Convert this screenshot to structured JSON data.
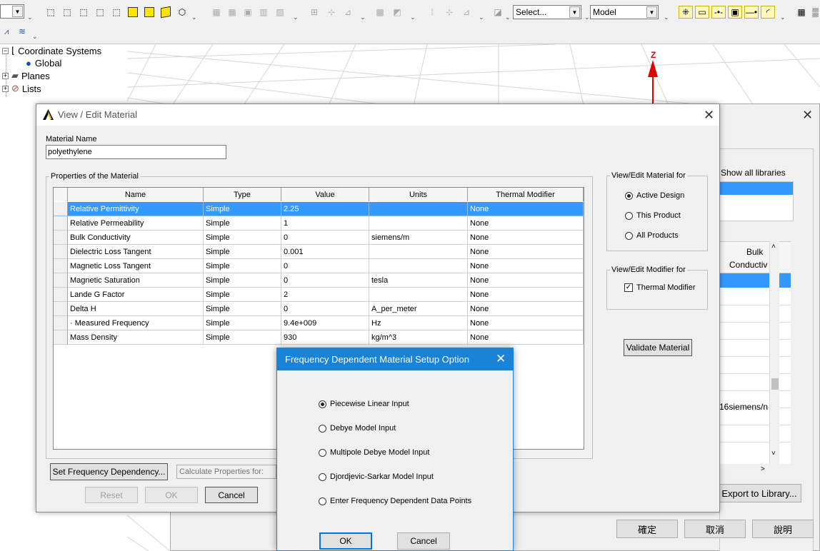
{
  "toolbar": {
    "select_value": "Select...",
    "model_value": "Model"
  },
  "tree": {
    "items": [
      {
        "label": "Coordinate Systems"
      },
      {
        "label": "Global"
      },
      {
        "label": "Planes"
      },
      {
        "label": "Lists"
      }
    ]
  },
  "viewport": {
    "axis_label": "Z"
  },
  "back_dialog": {
    "show_all_libraries": "Show all libraries",
    "col_header_line1": "Bulk",
    "col_header_line2": "Conductiv",
    "cell_value": "16siemens/n",
    "export_button": "Export to Library...",
    "ok_button": "確定",
    "cancel_button": "取消",
    "help_button": "說明"
  },
  "main_dialog": {
    "title": "View / Edit Material",
    "material_name_label": "Material Name",
    "material_name_value": "polyethylene",
    "properties_legend": "Properties of the Material",
    "columns": [
      "Name",
      "Type",
      "Value",
      "Units",
      "Thermal Modifier"
    ],
    "rows": [
      {
        "name": "Relative Permittivity",
        "type": "Simple",
        "value": "2.25",
        "units": "",
        "thermal": "None"
      },
      {
        "name": "Relative Permeability",
        "type": "Simple",
        "value": "1",
        "units": "",
        "thermal": "None"
      },
      {
        "name": "Bulk Conductivity",
        "type": "Simple",
        "value": "0",
        "units": "siemens/m",
        "thermal": "None"
      },
      {
        "name": "Dielectric Loss Tangent",
        "type": "Simple",
        "value": "0.001",
        "units": "",
        "thermal": "None"
      },
      {
        "name": "Magnetic Loss Tangent",
        "type": "Simple",
        "value": "0",
        "units": "",
        "thermal": "None"
      },
      {
        "name": "Magnetic Saturation",
        "type": "Simple",
        "value": "0",
        "units": "tesla",
        "thermal": "None"
      },
      {
        "name": "Lande G Factor",
        "type": "Simple",
        "value": "2",
        "units": "",
        "thermal": "None"
      },
      {
        "name": "Delta H",
        "type": "Simple",
        "value": "0",
        "units": "A_per_meter",
        "thermal": "None"
      },
      {
        "name": "· Measured Frequency",
        "type": "Simple",
        "value": "9.4e+009",
        "units": "Hz",
        "thermal": "None"
      },
      {
        "name": "Mass Density",
        "type": "Simple",
        "value": "930",
        "units": "kg/m^3",
        "thermal": "None"
      }
    ],
    "view_edit_for_legend": "View/Edit Material for",
    "scope_options": [
      "Active Design",
      "This Product",
      "All Products"
    ],
    "modifier_legend": "View/Edit Modifier for",
    "thermal_modifier_label": "Thermal Modifier",
    "validate_button": "Validate Material",
    "set_freq_button": "Set Frequency Dependency...",
    "calc_props_placeholder": "Calculate Properties for:",
    "reset_button": "Reset",
    "ok_button": "OK",
    "cancel_button": "Cancel"
  },
  "freq_dialog": {
    "title": "Frequency Dependent Material Setup Option",
    "options": [
      "Piecewise Linear Input",
      "Debye Model Input",
      "Multipole Debye Model Input",
      "Djordjevic-Sarkar Model Input",
      "Enter Frequency Dependent Data Points"
    ],
    "ok_button": "OK",
    "cancel_button": "Cancel"
  }
}
